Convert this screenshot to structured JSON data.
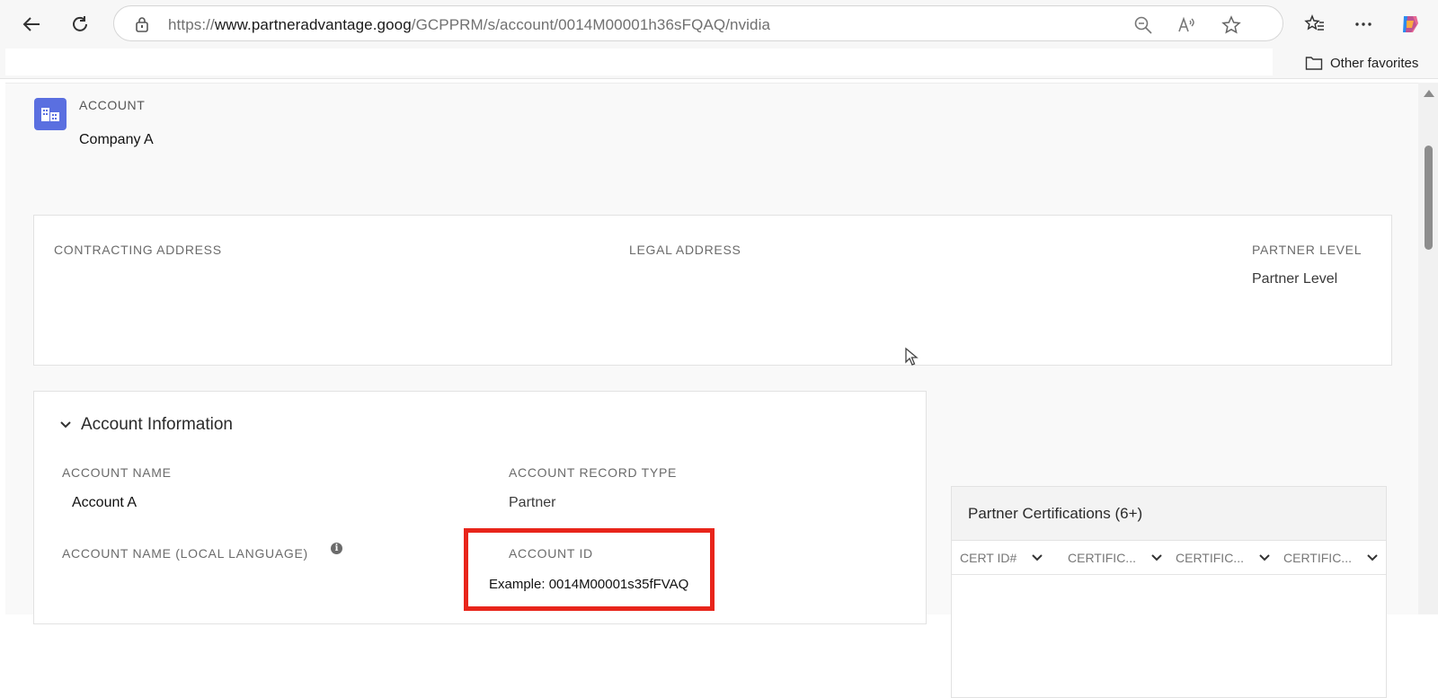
{
  "browser": {
    "url_prefix": "https://",
    "url_host": "www.partneradvantage.goog",
    "url_path": "/GCPPRM/s/account/0014M00001h36sFQAQ/nvidia",
    "other_favorites_label": "Other favorites"
  },
  "account_header": {
    "type_label": "ACCOUNT",
    "name": "Company A"
  },
  "address_card": {
    "contracting_address_label": "CONTRACTING ADDRESS",
    "legal_address_label": "LEGAL ADDRESS",
    "partner_level_label": "PARTNER LEVEL",
    "partner_level_value": "Partner Level"
  },
  "account_information": {
    "section_title": "Account Information",
    "account_name_label": "ACCOUNT NAME",
    "account_name_value": "Account A",
    "record_type_label": "ACCOUNT RECORD TYPE",
    "record_type_value": "Partner",
    "local_name_label": "ACCOUNT NAME (LOCAL LANGUAGE)",
    "account_id_label": "ACCOUNT ID",
    "account_id_value": "Example: 0014M00001s35fFVAQ"
  },
  "partner_certifications": {
    "title": "Partner Certifications (6+)",
    "columns": [
      "CERT ID#",
      "CERTIFIC...",
      "CERTIFIC...",
      "CERTIFIC..."
    ]
  },
  "colors": {
    "accent": "#5a6fe0",
    "highlight": "#e8251b"
  },
  "icons": [
    "back-arrow-icon",
    "refresh-icon",
    "lock-icon",
    "zoom-out-icon",
    "read-aloud-icon",
    "star-icon",
    "favorites-icon",
    "more-icon",
    "copilot-icon",
    "folder-icon",
    "account-icon",
    "chevron-down-icon",
    "info-icon"
  ]
}
